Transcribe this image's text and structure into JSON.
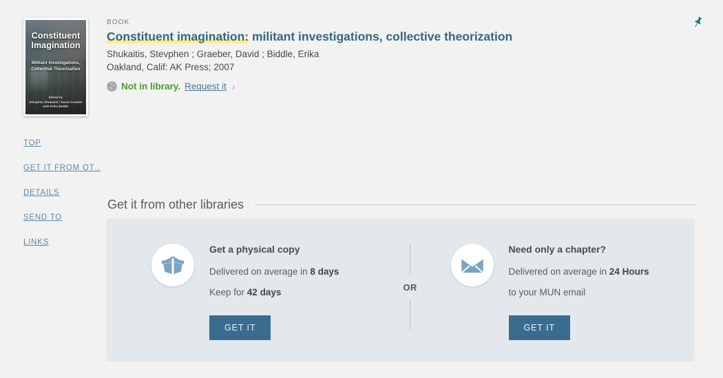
{
  "record": {
    "type_label": "BOOK",
    "title_highlighted": "Constituent imagination:",
    "title_rest": " militant investigations, collective theorization",
    "authors": "Shukaitis, Stevphen ; Graeber, David ; Biddle, Erika",
    "publication": "Oakland, Calif: AK Press; 2007",
    "availability_status": "Not in library.",
    "availability_action": "Request it",
    "availability_chevron": "›",
    "cover": {
      "title_line1": "Constituent",
      "title_line2": "Imagination",
      "subtitle_line1": "Militant Investigations,",
      "subtitle_line2": "Collective Theorization",
      "editors_line1": "Edited by",
      "editors_line2": "Stevphen Shukaitis / David Graeber",
      "editors_line3": "with Erika Biddle"
    },
    "pin_tooltip": "Pin this record"
  },
  "left_nav": {
    "items": [
      {
        "label": "TOP"
      },
      {
        "label": "GET IT FROM OT…"
      },
      {
        "label": "DETAILS"
      },
      {
        "label": "SEND TO"
      },
      {
        "label": "LINKS"
      }
    ]
  },
  "section": {
    "title": "Get it from other libraries"
  },
  "offers": {
    "separator_label": "OR",
    "physical": {
      "icon": "open-box-icon",
      "title": "Get a physical copy",
      "line1_prefix": "Delivered on average in ",
      "line1_strong": "8 days",
      "line2_prefix": "Keep for ",
      "line2_strong": "42 days",
      "button_label": "GET IT"
    },
    "chapter": {
      "icon": "envelope-icon",
      "title": "Need only a chapter?",
      "line1_prefix": "Delivered on average in ",
      "line1_strong": "24 Hours",
      "line2_prefix": "to your MUN email",
      "line2_strong": "",
      "button_label": "GET IT"
    }
  },
  "colors": {
    "page_background": "#f2f2f2",
    "card_background": "#e3e8ed",
    "link_blue": "#34687f",
    "nav_blue": "#5d87a8",
    "button_blue": "#3a6c92",
    "available_green": "#4f9a2f",
    "highlight_yellow": "#fced8a",
    "icon_blue": "#7aa4c6",
    "pin_teal": "#1c7a7e"
  }
}
